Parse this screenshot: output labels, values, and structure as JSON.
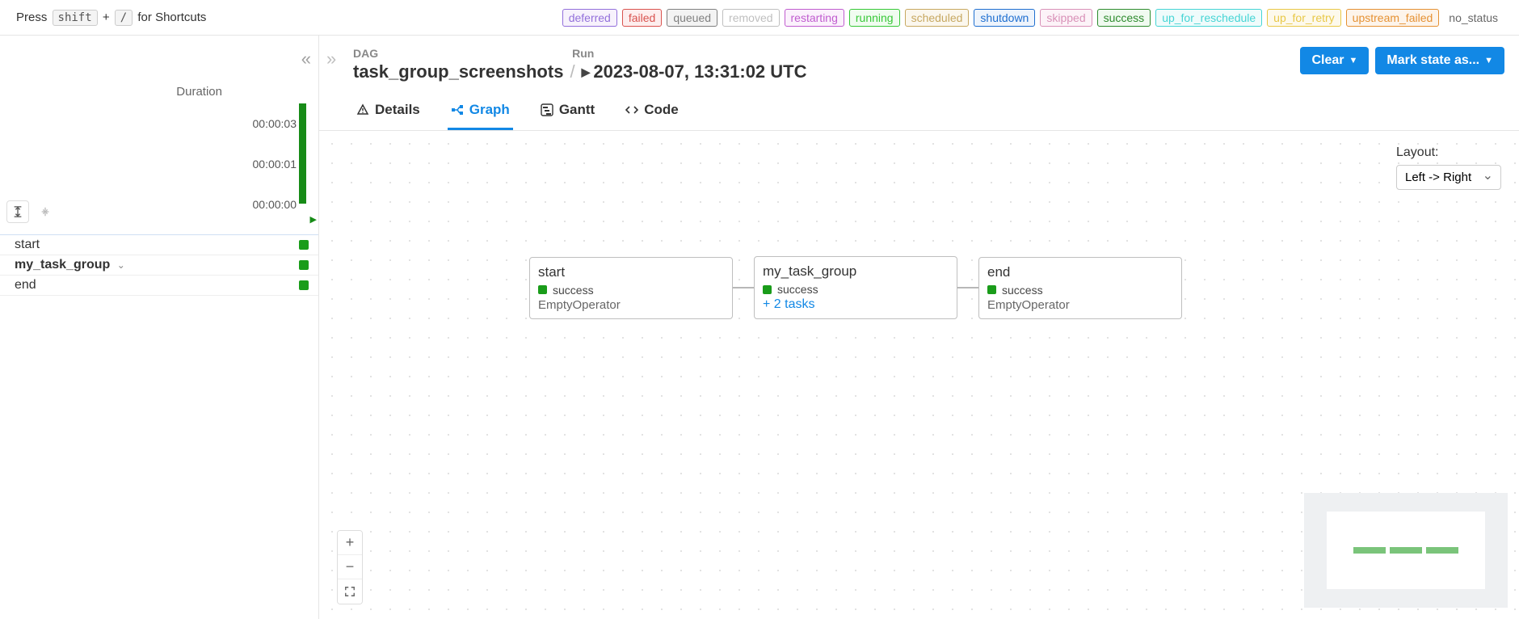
{
  "topbar": {
    "press": "Press",
    "shift": "shift",
    "plus": "+",
    "slash": "/",
    "for_shortcuts": "for Shortcuts"
  },
  "legend": [
    {
      "label": "deferred",
      "color": "#9370db",
      "bg": "#f7f2fc"
    },
    {
      "label": "failed",
      "color": "#d9534f",
      "bg": "#fdeeee"
    },
    {
      "label": "queued",
      "color": "#808080",
      "bg": "#f3f3f3"
    },
    {
      "label": "removed",
      "color": "#bfbfbf",
      "bg": "#ffffff"
    },
    {
      "label": "restarting",
      "color": "#c05ccf",
      "bg": "#fbf1fc"
    },
    {
      "label": "running",
      "color": "#37c837",
      "bg": "#f0fcf0"
    },
    {
      "label": "scheduled",
      "color": "#c7a861",
      "bg": "#fbf7ee"
    },
    {
      "label": "shutdown",
      "color": "#1f6fd0",
      "bg": "#eef4fc"
    },
    {
      "label": "skipped",
      "color": "#d991b8",
      "bg": "#fcf3f8"
    },
    {
      "label": "success",
      "color": "#2e8b2e",
      "bg": "#f0faf0"
    },
    {
      "label": "up_for_reschedule",
      "color": "#46d5d5",
      "bg": "#effbfb"
    },
    {
      "label": "up_for_retry",
      "color": "#e8c847",
      "bg": "#fdf9ec"
    },
    {
      "label": "upstream_failed",
      "color": "#e59133",
      "bg": "#fdf4eb"
    }
  ],
  "no_status_label": "no_status",
  "left": {
    "duration_title": "Duration",
    "ticks": [
      "00:00:03",
      "00:00:01",
      "00:00:00"
    ],
    "tasks": [
      {
        "name": "start",
        "group": false
      },
      {
        "name": "my_task_group",
        "group": true
      },
      {
        "name": "end",
        "group": false
      }
    ]
  },
  "header": {
    "dag_label": "DAG",
    "run_label": "Run",
    "dag_name": "task_group_screenshots",
    "run_time": "2023-08-07, 13:31:02 UTC",
    "clear": "Clear",
    "mark": "Mark state as..."
  },
  "tabs": {
    "details": "Details",
    "graph": "Graph",
    "gantt": "Gantt",
    "code": "Code"
  },
  "layout": {
    "label": "Layout:",
    "value": "Left -> Right"
  },
  "nodes": {
    "start": {
      "title": "start",
      "status": "success",
      "op": "EmptyOperator"
    },
    "group": {
      "title": "my_task_group",
      "status": "success",
      "expand": "+ 2 tasks"
    },
    "end": {
      "title": "end",
      "status": "success",
      "op": "EmptyOperator"
    }
  }
}
